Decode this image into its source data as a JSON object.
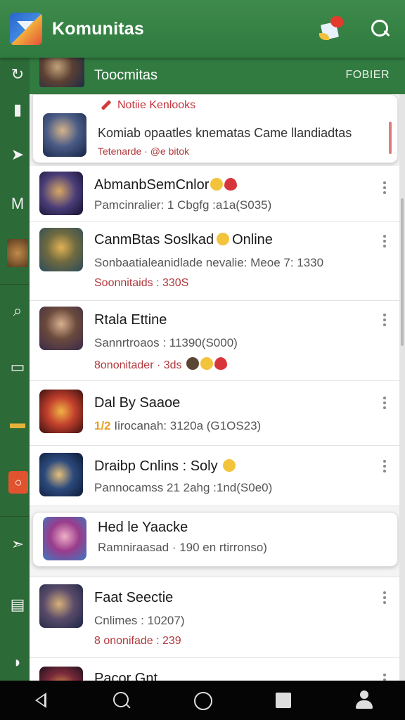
{
  "app": {
    "title": "Komunitas"
  },
  "header": {
    "title": "Toocmitas",
    "action": "FOBIER"
  },
  "notice": {
    "tag": "Notiie Kenlooks",
    "title": "Komiab opaatles knematas Came llandiadtas",
    "meta": "Tetenarde · @e bitok"
  },
  "items": [
    {
      "title": "AbmanbSemCnlor",
      "sub": "Pamcinralier: 1 Cbgfg :a1a(S035)",
      "meta": "",
      "icon": "face-emoji-icon"
    },
    {
      "title": "CanmBtas Soslkad",
      "title_tail": "Online",
      "sub": "Sonbaatialeanidlade nevalie: Meoe 7: 1330",
      "meta": "Soonnitaids : 330S",
      "icon": "face-emoji-icon"
    },
    {
      "title": "Rtala Ettine",
      "sub": "Sannrtroaos : 11390(S000)",
      "meta": "8ononitader · 3ds",
      "icon": "face-emoji-icon"
    },
    {
      "title": "Dal By Saaoe",
      "sub_prefix": "1/2",
      "sub": "Iirocanah: 3120a (G1OS23)",
      "meta": "",
      "icon": ""
    },
    {
      "title": "Draibp Cnlins : Soly",
      "sub": "Pannocamss 21 2ahg :1nd(S0e0)",
      "meta": "",
      "icon": "face-emoji-icon"
    },
    {
      "title": "Hed le Yaacke",
      "sub": "Ramniraasad · 190 en rtirronso)",
      "meta": "",
      "icon": ""
    },
    {
      "title": "Faat Seectie",
      "sub": "Cnlimes : 10207)",
      "meta": "8 ononifade : 239",
      "icon": ""
    },
    {
      "title": "Pacor Gnt",
      "sub": "",
      "meta": "",
      "icon": ""
    }
  ],
  "colors": {
    "brand": "#317a40",
    "accent_red": "#b0373b"
  }
}
